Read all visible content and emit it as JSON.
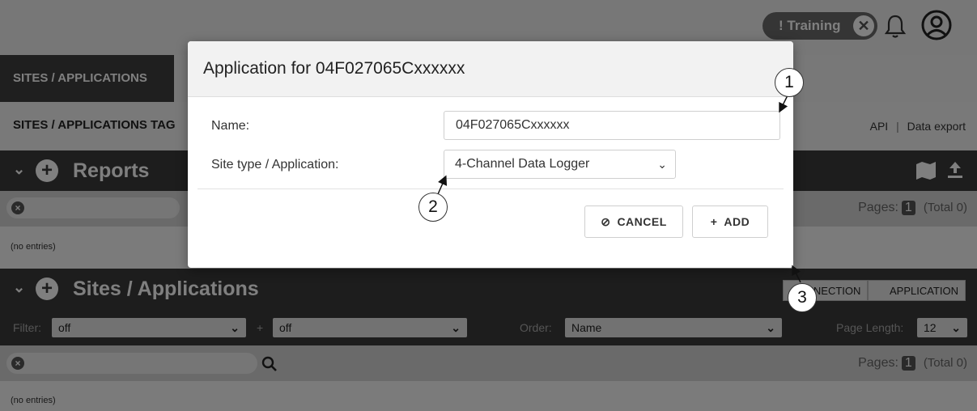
{
  "header": {
    "training_label": "! Training",
    "training_close": "✕"
  },
  "tabs": {
    "active_label": "SITES / APPLICATIONS"
  },
  "tags_bar": {
    "title": "SITES / APPLICATIONS TAG",
    "links": [
      "API",
      "|",
      "Data export"
    ]
  },
  "reports": {
    "title": "Reports",
    "pages_label": "Pages:",
    "page_num": "1",
    "total": "(Total 0)",
    "empty_text": "(no entries)"
  },
  "sites": {
    "title": "Sites / Applications",
    "toggle": [
      "CONNECTION",
      "APPLICATION"
    ],
    "filter_label": "Filter:",
    "filter1": "off",
    "plus_sep": "+",
    "filter2": "off",
    "order_label": "Order:",
    "order_value": "Name",
    "page_length_label": "Page Length:",
    "page_length_value": "12",
    "pages_label": "Pages:",
    "page_num": "1",
    "total": "(Total 0)",
    "empty_text": "(no entries)"
  },
  "dialog": {
    "title": "Application for 04F027065Cxxxxxx",
    "name_label": "Name:",
    "name_value": "04F027065Cxxxxxx",
    "type_label": "Site type / Application:",
    "type_value": "4-Channel Data Logger",
    "cancel_label": "CANCEL",
    "add_label": "ADD"
  },
  "callouts": [
    "1",
    "2",
    "3"
  ],
  "colors": {
    "dark_bar": "#3b3b3b",
    "overlay": "rgba(0,0,0,0.5)",
    "training_pill": "#6b6b6b"
  }
}
